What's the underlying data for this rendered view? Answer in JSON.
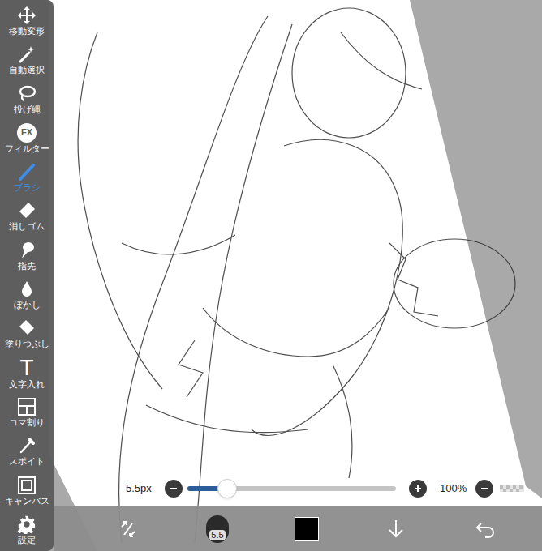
{
  "toolbar": {
    "items": [
      {
        "label": "移動変形",
        "icon": "move",
        "selected": false
      },
      {
        "label": "自動選択",
        "icon": "wand",
        "selected": false
      },
      {
        "label": "投げ縄",
        "icon": "lasso",
        "selected": false
      },
      {
        "label": "フィルター",
        "icon": "fx",
        "icon_text": "FX",
        "selected": false
      },
      {
        "label": "ブラシ",
        "icon": "brush",
        "selected": true
      },
      {
        "label": "消しゴム",
        "icon": "eraser",
        "selected": false
      },
      {
        "label": "指先",
        "icon": "finger",
        "selected": false
      },
      {
        "label": "ぼかし",
        "icon": "blur",
        "selected": false
      },
      {
        "label": "塗りつぶし",
        "icon": "fill",
        "selected": false
      },
      {
        "label": "文字入れ",
        "icon": "text",
        "icon_text": "T",
        "selected": false
      },
      {
        "label": "コマ割り",
        "icon": "frame",
        "selected": false
      },
      {
        "label": "スポイト",
        "icon": "dropper",
        "selected": false
      },
      {
        "label": "キャンバス",
        "icon": "canvas",
        "selected": false
      },
      {
        "label": "設定",
        "icon": "gear",
        "selected": false
      }
    ]
  },
  "brush_size": {
    "reading": "5.5px",
    "level": 0.19
  },
  "opacity": {
    "reading": "100%"
  },
  "bottom_bar": {
    "brush_preview": "5.5",
    "current_color": "#000000"
  }
}
